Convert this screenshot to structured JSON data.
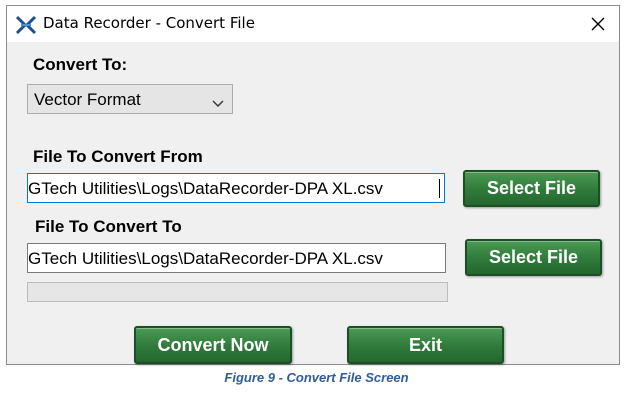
{
  "window": {
    "title": "Data Recorder - Convert File",
    "app_icon": "xdr-logo-icon",
    "close_icon": "close-icon"
  },
  "convert_to": {
    "label": "Convert To:",
    "selected": "Vector Format",
    "chevron_icon": "chevron-down-icon"
  },
  "source": {
    "label": "File To Convert From",
    "value": "GTech Utilities\\Logs\\DataRecorder-DPA XL.csv",
    "button": "Select File"
  },
  "destination": {
    "label": "File To Convert To",
    "value": "GTech Utilities\\Logs\\DataRecorder-DPA XL.csv",
    "button": "Select File"
  },
  "progress": {
    "value": 0
  },
  "actions": {
    "convert": "Convert Now",
    "exit": "Exit"
  },
  "caption": "Figure 9 - Convert File Screen",
  "colors": {
    "button_green": "#2f7a3a",
    "caption_blue": "#2f5d9a",
    "focus_border": "#0078d7"
  }
}
